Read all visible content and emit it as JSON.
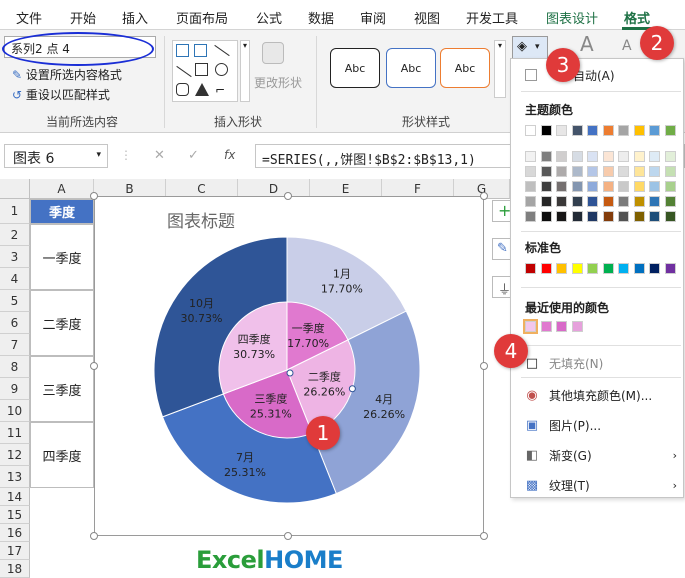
{
  "tabs": [
    "文件",
    "开始",
    "插入",
    "页面布局",
    "公式",
    "数据",
    "审阅",
    "视图",
    "开发工具",
    "图表设计",
    "格式"
  ],
  "current_selection": {
    "selector_value": "系列2 点 4",
    "format_selection": "设置所选内容格式",
    "reset_style": "重设以匹配样式",
    "group_label": "当前所选内容"
  },
  "insert_shapes": {
    "change_shape": "更改形状",
    "group_label": "插入形状"
  },
  "shape_styles": {
    "sample": "Abc",
    "group_label": "形状样式"
  },
  "name_box": "图表 6",
  "formula": "=SERIES(,,饼图!$B$2:$B$13,1)",
  "fx": "fx",
  "columns": [
    "A",
    "B",
    "C",
    "D",
    "E",
    "F",
    "G"
  ],
  "rows": [
    "1",
    "2",
    "3",
    "4",
    "5",
    "6",
    "7",
    "8",
    "9",
    "10",
    "11",
    "12",
    "13",
    "14",
    "15",
    "16",
    "17",
    "18"
  ],
  "cells_a": [
    "季度",
    "一季度",
    "二季度",
    "三季度",
    "四季度"
  ],
  "chart_data": {
    "type": "pie",
    "title": "图表标题",
    "outer": {
      "labels": [
        "1月",
        "4月",
        "7月",
        "10月"
      ],
      "values": [
        17.7,
        26.26,
        25.31,
        30.73
      ],
      "display": [
        "17.70%",
        "26.26%",
        "25.31%",
        "30.73%"
      ],
      "colors": [
        "#c9cee8",
        "#8fa3d6",
        "#4472c4",
        "#2f5597"
      ]
    },
    "inner": {
      "labels": [
        "一季度",
        "二季度",
        "三季度",
        "四季度"
      ],
      "values": [
        17.7,
        26.26,
        25.31,
        30.73
      ],
      "display": [
        "17.70%",
        "26.26%",
        "25.31%",
        "30.73%"
      ],
      "colors": [
        "#e079cf",
        "#eeb4e4",
        "#d86ac8",
        "#f0c0ea"
      ]
    }
  },
  "color_panel": {
    "auto_label": "自动(A)",
    "theme_title": "主题颜色",
    "theme_top": [
      "#ffffff",
      "#000000",
      "#e7e6e6",
      "#44546a",
      "#4472c4",
      "#ed7d31",
      "#a5a5a5",
      "#ffc000",
      "#5b9bd5",
      "#70ad47"
    ],
    "theme_shades": [
      [
        "#f2f2f2",
        "#7f7f7f",
        "#d0cece",
        "#d6dce4",
        "#d9e2f3",
        "#fbe5d5",
        "#ededed",
        "#fff2cc",
        "#deebf6",
        "#e2efd9"
      ],
      [
        "#d8d8d8",
        "#595959",
        "#aeabab",
        "#adb9ca",
        "#b4c6e7",
        "#f7cbac",
        "#dbdbdb",
        "#fee599",
        "#bdd7ee",
        "#c5e0b3"
      ],
      [
        "#bfbfbf",
        "#3f3f3f",
        "#757070",
        "#8496b0",
        "#8eaadb",
        "#f4b183",
        "#c9c9c9",
        "#ffd965",
        "#9cc3e5",
        "#a8d08d"
      ],
      [
        "#a5a5a5",
        "#262626",
        "#3a3838",
        "#323f4f",
        "#2f5496",
        "#c55a11",
        "#7b7b7b",
        "#bf9000",
        "#2e75b5",
        "#538135"
      ],
      [
        "#7f7f7f",
        "#0c0c0c",
        "#171616",
        "#222a35",
        "#1f3864",
        "#833c0b",
        "#525252",
        "#7f6000",
        "#1e4e79",
        "#375623"
      ]
    ],
    "standard_title": "标准色",
    "standard": [
      "#c00000",
      "#ff0000",
      "#ffc000",
      "#ffff00",
      "#92d050",
      "#00b050",
      "#00b0f0",
      "#0070c0",
      "#002060",
      "#7030a0"
    ],
    "recent_title": "最近使用的颜色",
    "recent": [
      "#f3c7ec",
      "#e079cf",
      "#d86ac8",
      "#e6a1dc"
    ],
    "no_fill": "无填充(N)",
    "more_colors": "其他填充颜色(M)...",
    "picture": "图片(P)...",
    "gradient": "渐变(G)",
    "texture": "纹理(T)"
  },
  "markers": [
    "1",
    "2",
    "3",
    "4"
  ],
  "logo": {
    "part1": "Excel",
    "part2": "HOME"
  }
}
